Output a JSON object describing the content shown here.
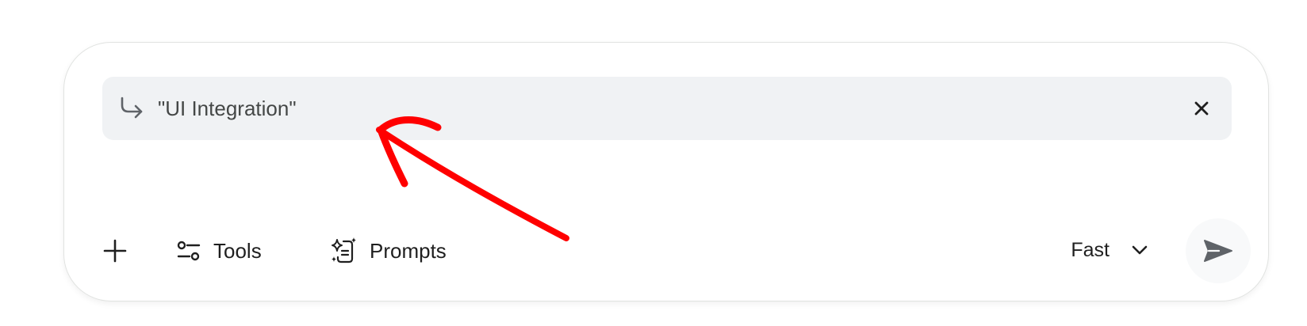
{
  "composer": {
    "quote": {
      "text": "\"UI Integration\"",
      "icon": "reply-arrow-icon",
      "close_icon": "close-icon"
    },
    "toolbar": {
      "add_icon": "plus-icon",
      "tools_label": "Tools",
      "tools_icon": "tune-icon",
      "prompts_label": "Prompts",
      "prompts_icon": "sparkle-prompts-icon",
      "model_label": "Fast",
      "model_icon": "chevron-down-icon",
      "send_icon": "send-icon"
    }
  },
  "annotation": {
    "type": "red-arrow",
    "color": "#ff0000"
  },
  "colors": {
    "quote_bar_bg": "#f0f2f4",
    "text_primary": "#1f1f1f",
    "text_secondary": "#444746",
    "send_icon": "#5f6368"
  }
}
